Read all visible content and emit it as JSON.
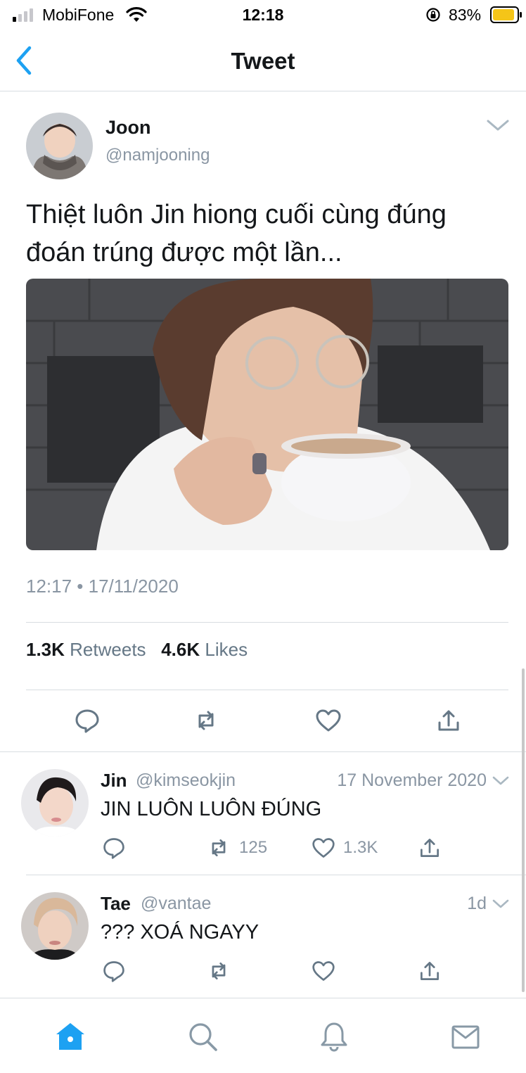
{
  "status_bar": {
    "carrier": "MobiFone",
    "time": "12:18",
    "battery_percent": "83%",
    "battery_color": "#f5c518"
  },
  "nav": {
    "title": "Tweet",
    "back_icon": "chevron-left-icon"
  },
  "tweet": {
    "author_name": "Joon",
    "author_handle": "@namjooning",
    "text": "Thiệt luôn Jin hiong cuối cùng đúng đoán trúng được một lần...",
    "timestamp": "12:17 • 17/11/2020",
    "retweets_count": "1.3K",
    "retweets_label": "Retweets",
    "likes_count": "4.6K",
    "likes_label": "Likes",
    "actions": [
      "reply-icon",
      "retweet-icon",
      "like-icon",
      "share-icon"
    ]
  },
  "replies": [
    {
      "name": "Jin",
      "handle": "@kimseokjin",
      "date": "17 November 2020",
      "text": "JIN LUÔN LUÔN ĐÚNG",
      "retweets": "125",
      "likes": "1.3K"
    },
    {
      "name": "Tae",
      "handle": "@vantae",
      "date": "1d",
      "text": "??? XOÁ NGAYY",
      "retweets": "",
      "likes": ""
    }
  ],
  "tab_bar": {
    "tabs": [
      "home-icon",
      "search-icon",
      "notifications-icon",
      "messages-icon"
    ],
    "active": "home-icon"
  },
  "colors": {
    "accent": "#1da1f2",
    "secondary_text": "#8a96a3",
    "icon_gray": "#657786"
  }
}
